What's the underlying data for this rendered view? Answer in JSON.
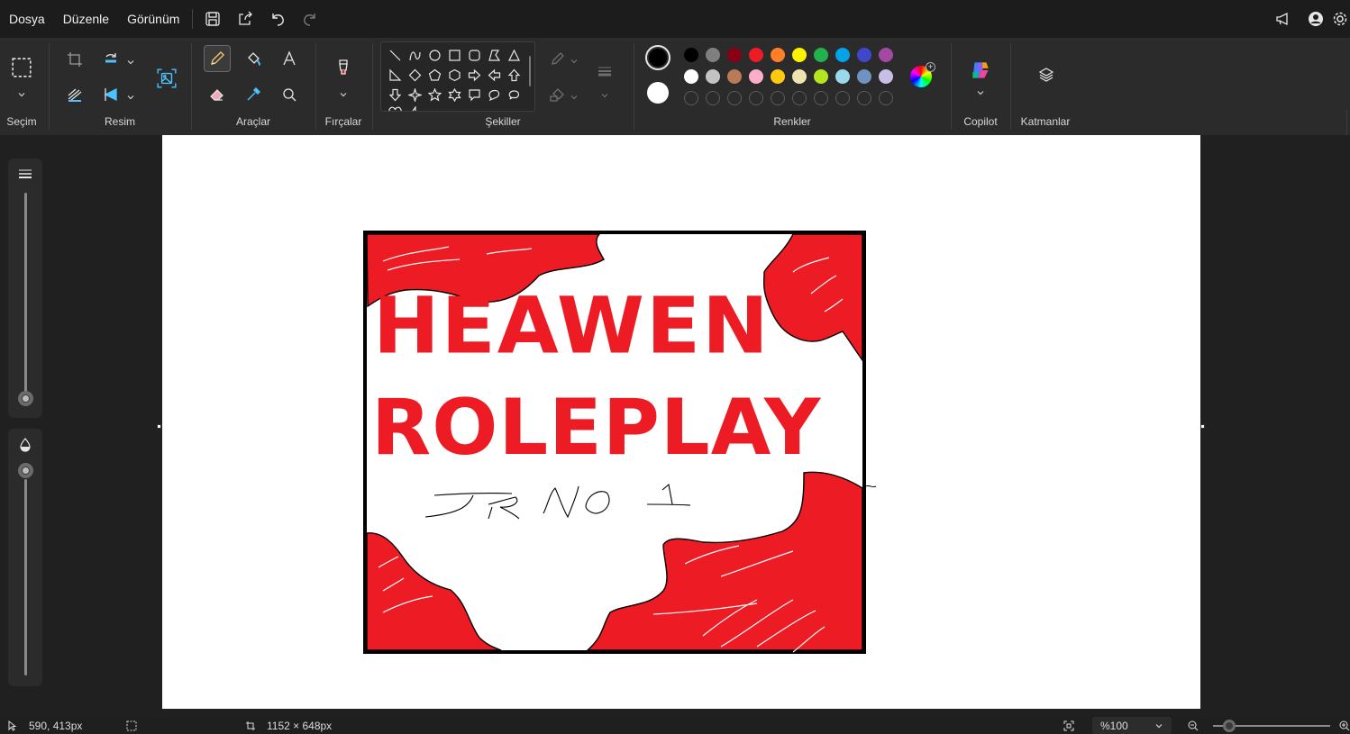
{
  "menu": {
    "file": "Dosya",
    "edit": "Düzenle",
    "view": "Görünüm"
  },
  "ribbon": {
    "selection_label": "Seçim",
    "image_label": "Resim",
    "tools_label": "Araçlar",
    "brushes_label": "Fırçalar",
    "shapes_label": "Şekiller",
    "colors_label": "Renkler",
    "copilot_label": "Copilot",
    "layers_label": "Katmanlar"
  },
  "colors": {
    "primary": "#000000",
    "secondary": "#ffffff",
    "row1": [
      "#000000",
      "#7f7f7f",
      "#880015",
      "#ed1c24",
      "#ff7f27",
      "#fff200",
      "#22b14c",
      "#00a2e8",
      "#3f48cc",
      "#a349a4"
    ],
    "row2": [
      "#ffffff",
      "#c3c3c3",
      "#b97a57",
      "#ffaec9",
      "#ffc90e",
      "#efe4b0",
      "#b5e61d",
      "#99d9ea",
      "#7092be",
      "#c8bfe7"
    ]
  },
  "drawing": {
    "title_line1": "HEAWEN",
    "title_line2": "ROLEPLAY",
    "accent": "#ed1c24",
    "sketch_text": "JR NO 1"
  },
  "status": {
    "cursor_pos": "590, 413px",
    "canvas_size": "1152 × 648px",
    "zoom": "%100"
  }
}
